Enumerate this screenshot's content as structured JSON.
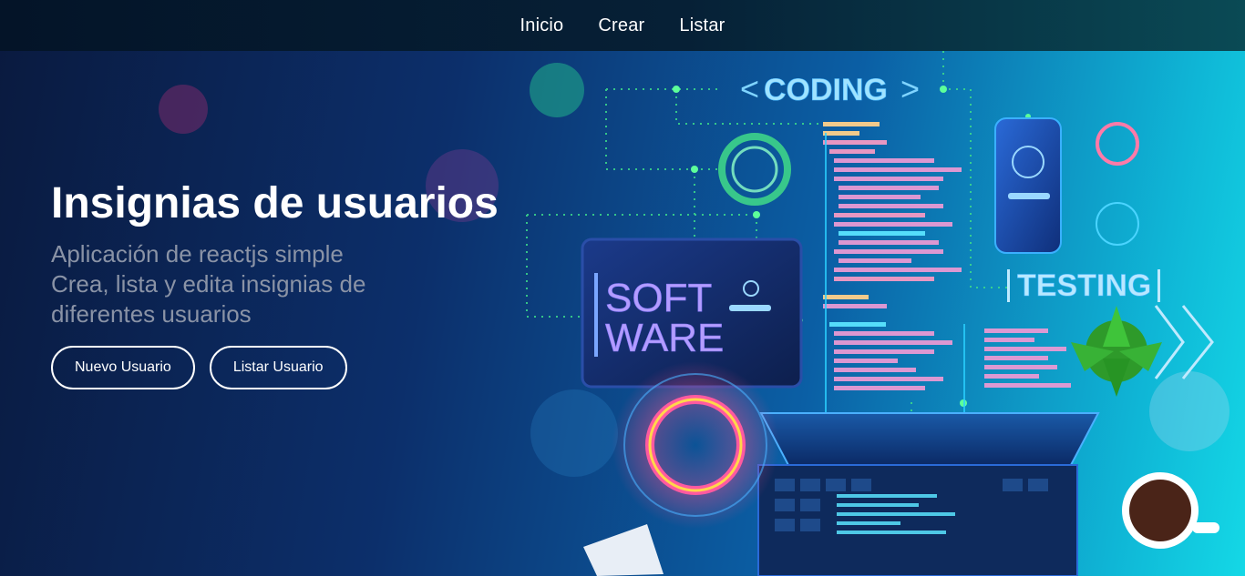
{
  "nav": {
    "links": [
      "Inicio",
      "Crear",
      "Listar"
    ]
  },
  "hero": {
    "title": "Insignias de usuarios",
    "subtitle_line1": "Aplicación de reactjs simple",
    "subtitle_line2": "Crea, lista y edita insignias de diferentes usuarios",
    "buttons": {
      "new_user": "Nuevo Usuario",
      "list_user": "Listar Usuario"
    }
  },
  "illustration": {
    "coding_label": "CODING",
    "testing_label": "TESTING",
    "software_line1": "SOFT",
    "software_line2": "WARE"
  }
}
